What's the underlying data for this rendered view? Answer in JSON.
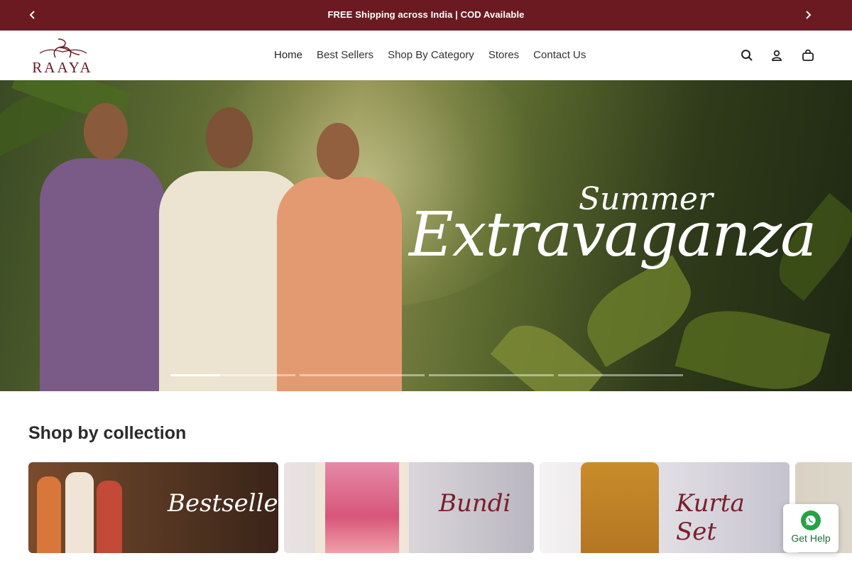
{
  "announcement": {
    "message": "FREE Shipping across India | COD Available",
    "prev_icon": "chevron-left-icon",
    "next_icon": "chevron-right-icon"
  },
  "header": {
    "logo_text": "RAAYA",
    "nav": [
      {
        "label": "Home"
      },
      {
        "label": "Best Sellers"
      },
      {
        "label": "Shop By Category"
      },
      {
        "label": "Stores"
      },
      {
        "label": "Contact Us"
      }
    ],
    "icons": [
      "search-icon",
      "account-icon",
      "cart-icon"
    ]
  },
  "hero": {
    "headline_small": "Summer",
    "headline_big": "Extravaganza",
    "slide_count": 4,
    "active_slide": 1,
    "active_progress": 0.4
  },
  "collections": {
    "title": "Shop by collection",
    "items": [
      {
        "label": "Bestsellers"
      },
      {
        "label": "Bundi"
      },
      {
        "label": "Kurta Set"
      },
      {
        "label": ""
      }
    ]
  },
  "help": {
    "label": "Get Help",
    "icon": "whatsapp-icon",
    "accent": "#25a244"
  },
  "colors": {
    "brand": "#6b1a21"
  }
}
